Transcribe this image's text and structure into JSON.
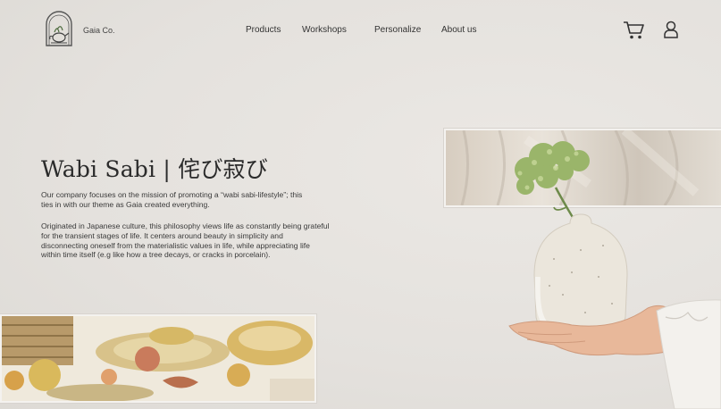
{
  "header": {
    "brand": "Gaia Co.",
    "logo_icon": "teapot-logo-icon",
    "nav": [
      "Products",
      "Workshops",
      "Personalize",
      "About us"
    ],
    "cart_icon": "cart-icon",
    "user_icon": "user-icon"
  },
  "hero": {
    "title": "Wabi Sabi | 侘び寂び",
    "paragraph_1": "Our company focuses on the mission of promoting a “wabi sabi-lifestyle”; this ties in with our theme as Gaia created everything.",
    "paragraph_2": "Originated in Japanese culture, this philosophy views life as constantly being grateful for the transient stages of life. It centers around beauty in simplicity and disconnecting oneself from the materialistic values in life, while appreciating life within time itself (e.g like how a tree decays, or cracks in porcelain)."
  },
  "images": {
    "curtain": "sunlit-curtain-photo",
    "food": "peaches-and-ceramic-plates-photo",
    "vase": "hands-holding-vase-with-flowers-photo"
  },
  "colors": {
    "background": "#e6e3df",
    "text": "#2b2b2b",
    "frame": "#f4f2ef"
  }
}
